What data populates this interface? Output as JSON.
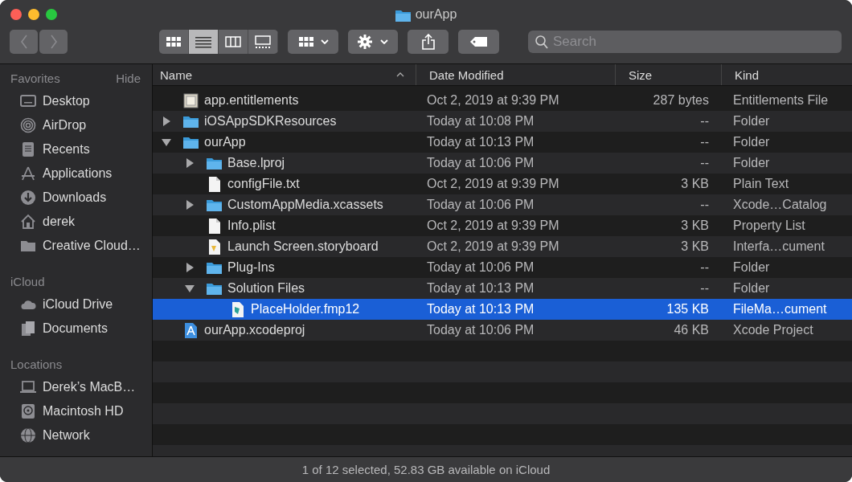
{
  "window": {
    "title": "ourApp"
  },
  "toolbar": {
    "views": [
      {
        "kind": "icons",
        "selected": false
      },
      {
        "kind": "list",
        "selected": true
      },
      {
        "kind": "columns",
        "selected": false
      },
      {
        "kind": "gallery",
        "selected": false
      }
    ],
    "search": {
      "placeholder": "Search"
    }
  },
  "sidebar": {
    "sections": [
      {
        "title": "Favorites",
        "action": "Hide",
        "items": [
          {
            "label": "Desktop",
            "kind": "desktop"
          },
          {
            "label": "AirDrop",
            "kind": "airdrop"
          },
          {
            "label": "Recents",
            "kind": "recents"
          },
          {
            "label": "Applications",
            "kind": "applications"
          },
          {
            "label": "Downloads",
            "kind": "downloads"
          },
          {
            "label": "derek",
            "kind": "home"
          },
          {
            "label": "Creative Cloud…",
            "kind": "folder"
          }
        ]
      },
      {
        "title": "iCloud",
        "items": [
          {
            "label": "iCloud Drive",
            "kind": "cloud"
          },
          {
            "label": "Documents",
            "kind": "documents"
          }
        ]
      },
      {
        "title": "Locations",
        "items": [
          {
            "label": "Derek’s MacB…",
            "kind": "laptop"
          },
          {
            "label": "Macintosh HD",
            "kind": "disk"
          },
          {
            "label": "Network",
            "kind": "network"
          }
        ]
      }
    ]
  },
  "file_list": {
    "columns": [
      {
        "label": "Name",
        "sorted": true
      },
      {
        "label": "Date Modified",
        "sorted": false
      },
      {
        "label": "Size",
        "sorted": false
      },
      {
        "label": "Kind",
        "sorted": false
      }
    ],
    "rows": [
      {
        "name": "app.entitlements",
        "kind": "entitlements",
        "date_modified": "Oct 2, 2019 at 9:39 PM",
        "size": "287 bytes",
        "file_kind": "Entitlements File",
        "selected": false
      },
      {
        "name": "iOSAppSDKResources",
        "kind": "folder",
        "expanded": false,
        "date_modified": "Today at 10:08 PM",
        "size": "--",
        "file_kind": "Folder",
        "selected": false
      },
      {
        "name": "ourApp",
        "kind": "folder",
        "expanded": true,
        "date_modified": "Today at 10:13 PM",
        "size": "--",
        "file_kind": "Folder",
        "selected": false,
        "children": [
          {
            "name": "Base.lproj",
            "kind": "folder",
            "expanded": false,
            "date_modified": "Today at 10:06 PM",
            "size": "--",
            "file_kind": "Folder",
            "selected": false
          },
          {
            "name": "configFile.txt",
            "kind": "text",
            "date_modified": "Oct 2, 2019 at 9:39 PM",
            "size": "3 KB",
            "file_kind": "Plain Text",
            "selected": false
          },
          {
            "name": "CustomAppMedia.xcassets",
            "kind": "folder",
            "expanded": false,
            "date_modified": "Today at 10:06 PM",
            "size": "--",
            "file_kind": "Xcode…Catalog",
            "selected": false
          },
          {
            "name": "Info.plist",
            "kind": "text",
            "date_modified": "Oct 2, 2019 at 9:39 PM",
            "size": "3 KB",
            "file_kind": "Property List",
            "selected": false
          },
          {
            "name": "Launch Screen.storyboard",
            "kind": "storyboard",
            "date_modified": "Oct 2, 2019 at 9:39 PM",
            "size": "3 KB",
            "file_kind": "Interfa…cument",
            "selected": false
          },
          {
            "name": "Plug-Ins",
            "kind": "folder",
            "expanded": false,
            "date_modified": "Today at 10:06 PM",
            "size": "--",
            "file_kind": "Folder",
            "selected": false
          },
          {
            "name": "Solution Files",
            "kind": "folder",
            "expanded": true,
            "date_modified": "Today at 10:13 PM",
            "size": "--",
            "file_kind": "Folder",
            "selected": false,
            "children": [
              {
                "name": "PlaceHolder.fmp12",
                "kind": "database",
                "date_modified": "Today at 10:13 PM",
                "size": "135 KB",
                "file_kind": "FileMa…cument",
                "selected": true
              }
            ]
          }
        ]
      },
      {
        "name": "ourApp.xcodeproj",
        "kind": "project",
        "date_modified": "Today at 10:06 PM",
        "size": "46 KB",
        "file_kind": "Xcode Project",
        "selected": false
      }
    ]
  },
  "status_bar": "1 of 12 selected, 52.83 GB available on iCloud"
}
